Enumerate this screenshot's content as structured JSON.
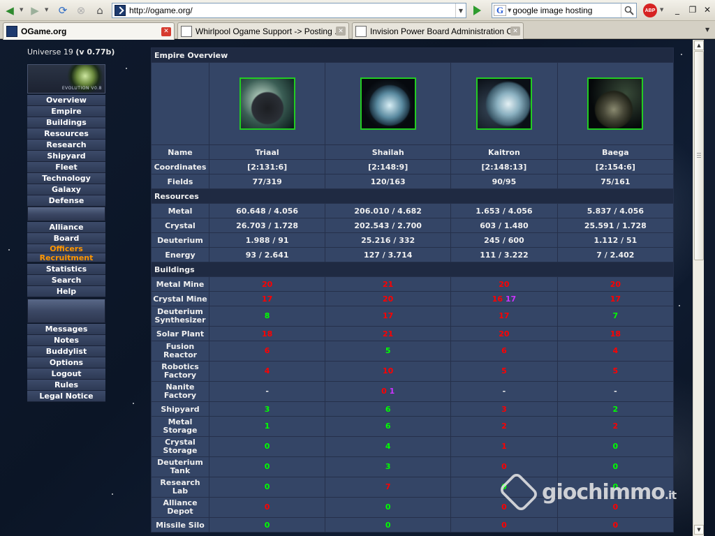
{
  "browser": {
    "url": "http://ogame.org/",
    "search_value": "google image hosting",
    "search_engine_icon": "G",
    "adblock_label": "ABP",
    "tabs": [
      {
        "label": "OGame.org",
        "active": true
      },
      {
        "label": "Whirlpool Ogame Support -> Posting ...",
        "active": false
      },
      {
        "label": "Invision Power Board Administration C...",
        "active": false
      }
    ]
  },
  "sidebar": {
    "universe_label": "Universe 19",
    "version": "(v 0.77b)",
    "logo_text": "EVOLUTION V0.8",
    "group1": [
      "Overview",
      "Empire",
      "Buildings",
      "Resources",
      "Research",
      "Shipyard",
      "Fleet",
      "Technology",
      "Galaxy",
      "Defense"
    ],
    "group2": [
      "Alliance",
      "Board"
    ],
    "officers": "Officers",
    "recruitment": "Recruitment",
    "group3": [
      "Statistics",
      "Search",
      "Help"
    ],
    "group4": [
      "Messages",
      "Notes",
      "Buddylist",
      "Options",
      "Logout",
      "Rules",
      "Legal Notice"
    ]
  },
  "empire": {
    "title": "Empire Overview",
    "label_name": "Name",
    "label_coords": "Coordinates",
    "label_fields": "Fields",
    "resources_title": "Resources",
    "buildings_title": "Buildings",
    "planets": [
      {
        "name": "Triaal",
        "coords": "[2:131:6]",
        "fields": "77/319"
      },
      {
        "name": "Shailah",
        "coords": "[2:148:9]",
        "fields": "120/163"
      },
      {
        "name": "Kaitron",
        "coords": "[2:148:13]",
        "fields": "90/95"
      },
      {
        "name": "Baega",
        "coords": "[2:154:6]",
        "fields": "75/161"
      }
    ],
    "resources": [
      {
        "label": "Metal",
        "values": [
          "60.648 / 4.056",
          "206.010 / 4.682",
          "1.653 / 4.056",
          "5.837 / 4.056"
        ]
      },
      {
        "label": "Crystal",
        "values": [
          "26.703 / 1.728",
          "202.543 / 2.700",
          "603 / 1.480",
          "25.591 / 1.728"
        ]
      },
      {
        "label": "Deuterium",
        "values": [
          "1.988 / 91",
          "25.216 / 332",
          "245 / 600",
          "1.112 / 51"
        ]
      },
      {
        "label": "Energy",
        "values": [
          "93 / 2.641",
          "127 / 3.714",
          "111 / 3.222",
          "7 / 2.402"
        ]
      }
    ],
    "buildings": [
      {
        "label": "Metal Mine",
        "cells": [
          {
            "v": "20",
            "c": "red"
          },
          {
            "v": "21",
            "c": "red"
          },
          {
            "v": "20",
            "c": "red"
          },
          {
            "v": "20",
            "c": "red"
          }
        ]
      },
      {
        "label": "Crystal Mine",
        "cells": [
          {
            "v": "17",
            "c": "red"
          },
          {
            "v": "20",
            "c": "red"
          },
          {
            "v": "16",
            "c": "red",
            "extra": "17",
            "extra_c": "purple"
          },
          {
            "v": "17",
            "c": "red"
          }
        ]
      },
      {
        "label": "Deuterium Synthesizer",
        "cells": [
          {
            "v": "8",
            "c": "green"
          },
          {
            "v": "17",
            "c": "red"
          },
          {
            "v": "17",
            "c": "red"
          },
          {
            "v": "7",
            "c": "green"
          }
        ]
      },
      {
        "label": "Solar Plant",
        "cells": [
          {
            "v": "18",
            "c": "red"
          },
          {
            "v": "21",
            "c": "red"
          },
          {
            "v": "20",
            "c": "red"
          },
          {
            "v": "18",
            "c": "red"
          }
        ]
      },
      {
        "label": "Fusion Reactor",
        "cells": [
          {
            "v": "6",
            "c": "red"
          },
          {
            "v": "5",
            "c": "green"
          },
          {
            "v": "6",
            "c": "red"
          },
          {
            "v": "4",
            "c": "red"
          }
        ]
      },
      {
        "label": "Robotics Factory",
        "cells": [
          {
            "v": "4",
            "c": "red"
          },
          {
            "v": "10",
            "c": "red"
          },
          {
            "v": "5",
            "c": "red"
          },
          {
            "v": "5",
            "c": "red"
          }
        ]
      },
      {
        "label": "Nanite Factory",
        "cells": [
          {
            "v": "-",
            "c": "white"
          },
          {
            "v": "0",
            "c": "red",
            "extra": "1",
            "extra_c": "purple"
          },
          {
            "v": "-",
            "c": "white"
          },
          {
            "v": "-",
            "c": "white"
          }
        ]
      },
      {
        "label": "Shipyard",
        "cells": [
          {
            "v": "3",
            "c": "green"
          },
          {
            "v": "6",
            "c": "green"
          },
          {
            "v": "3",
            "c": "red"
          },
          {
            "v": "2",
            "c": "green"
          }
        ]
      },
      {
        "label": "Metal Storage",
        "cells": [
          {
            "v": "1",
            "c": "green"
          },
          {
            "v": "6",
            "c": "green"
          },
          {
            "v": "2",
            "c": "red"
          },
          {
            "v": "2",
            "c": "red"
          }
        ]
      },
      {
        "label": "Crystal Storage",
        "cells": [
          {
            "v": "0",
            "c": "green"
          },
          {
            "v": "4",
            "c": "green"
          },
          {
            "v": "1",
            "c": "red"
          },
          {
            "v": "0",
            "c": "green"
          }
        ]
      },
      {
        "label": "Deuterium Tank",
        "cells": [
          {
            "v": "0",
            "c": "green"
          },
          {
            "v": "3",
            "c": "green"
          },
          {
            "v": "0",
            "c": "red"
          },
          {
            "v": "0",
            "c": "green"
          }
        ]
      },
      {
        "label": "Research Lab",
        "cells": [
          {
            "v": "0",
            "c": "green"
          },
          {
            "v": "7",
            "c": "red"
          },
          {
            "v": "0",
            "c": "green"
          },
          {
            "v": "0",
            "c": "green"
          }
        ]
      },
      {
        "label": "Alliance Depot",
        "cells": [
          {
            "v": "0",
            "c": "red"
          },
          {
            "v": "0",
            "c": "green"
          },
          {
            "v": "0",
            "c": "red"
          },
          {
            "v": "0",
            "c": "red"
          }
        ]
      },
      {
        "label": "Missile Silo",
        "cells": [
          {
            "v": "0",
            "c": "green"
          },
          {
            "v": "0",
            "c": "green"
          },
          {
            "v": "0",
            "c": "red"
          },
          {
            "v": "0",
            "c": "red"
          }
        ]
      }
    ]
  },
  "watermark": {
    "text": "giochimmo",
    "suffix": ".it"
  }
}
